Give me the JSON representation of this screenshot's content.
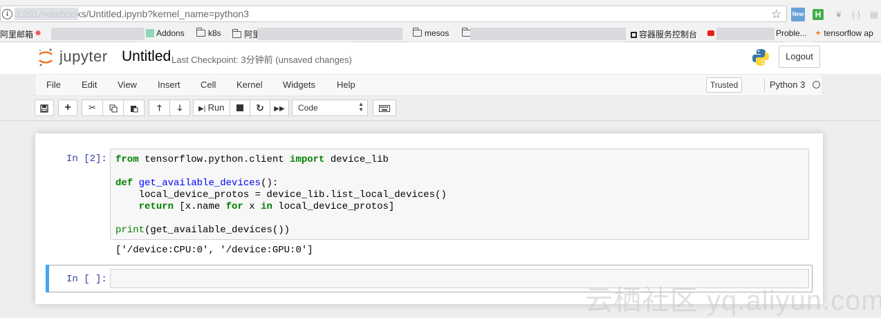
{
  "browser": {
    "url": "3.201/notebooks/Untitled.ipynb?kernel_name=python3",
    "extensions": [
      "new-badge",
      "h-extension",
      "leaf",
      "code-brackets",
      "printer"
    ],
    "bookmarks": [
      {
        "label": "阿里邮箱",
        "icon": "envelope"
      },
      {
        "label": "Addons",
        "icon": "web"
      },
      {
        "label": "k8s",
        "icon": "folder"
      },
      {
        "label": "阿里",
        "icon": "folder"
      },
      {
        "label": "mesos",
        "icon": "folder"
      },
      {
        "label": "容器服务控制台",
        "icon": "square"
      },
      {
        "label": "Proble...",
        "icon": "youtube"
      },
      {
        "label": "tensorflow ap",
        "icon": "tensorflow"
      }
    ]
  },
  "header": {
    "logo_text": "jupyter",
    "notebook_name": "Untitled",
    "checkpoint": "Last Checkpoint: 3分钟前 (unsaved changes)",
    "logout_label": "Logout"
  },
  "menubar": {
    "items": [
      "File",
      "Edit",
      "View",
      "Insert",
      "Cell",
      "Kernel",
      "Widgets",
      "Help"
    ],
    "trusted_label": "Trusted",
    "kernel_label": "Python 3"
  },
  "toolbar": {
    "run_label": "Run",
    "cell_type": "Code"
  },
  "cells": [
    {
      "prompt": "In [2]:",
      "code": [
        "from tensorflow.python.client import device_lib",
        "",
        "def get_available_devices():",
        "    local_device_protos = device_lib.list_local_devices()",
        "    return [x.name for x in local_device_protos]",
        "",
        "print(get_available_devices())"
      ],
      "output": "['/device:CPU:0', '/device:GPU:0']"
    },
    {
      "prompt": "In [ ]:",
      "code": []
    }
  ],
  "watermark": "云栖社区 yq.aliyun.com"
}
